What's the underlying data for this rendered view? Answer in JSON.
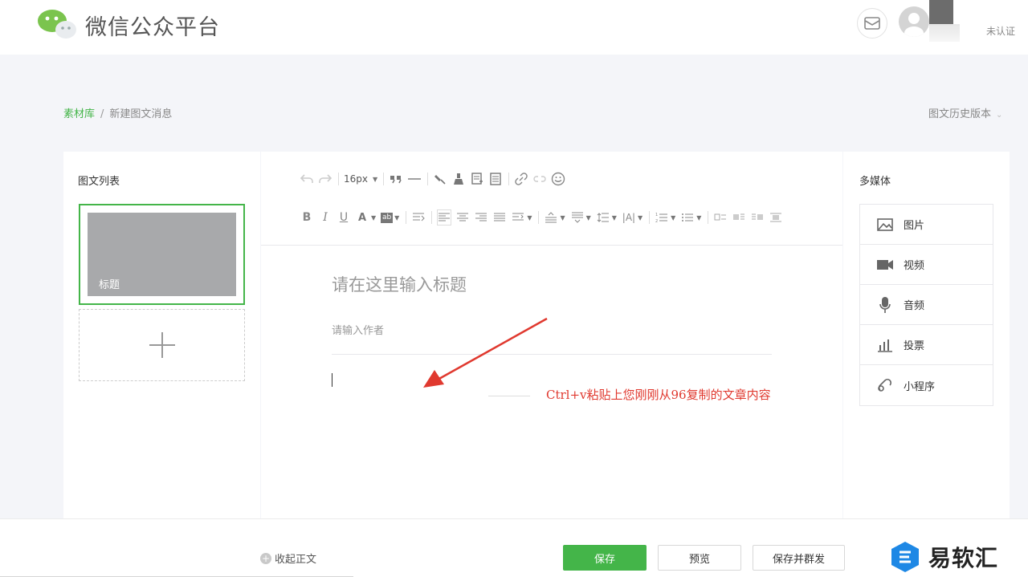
{
  "header": {
    "brand": "微信公众平台",
    "verify_status": "未认证"
  },
  "breadcrumb": {
    "home": "素材库",
    "separator": "/",
    "current": "新建图文消息",
    "history": "图文历史版本"
  },
  "left_panel": {
    "title": "图文列表",
    "card_title": "标题",
    "add_icon": "plus-icon"
  },
  "toolbar": {
    "font_size": "16px",
    "row1_icons": [
      "undo-icon",
      "redo-icon",
      "font-size-select",
      "blockquote-icon",
      "horizontal-rule-icon",
      "format-painter-icon",
      "clear-format-icon",
      "insert-template-icon",
      "insert-doc-icon",
      "link-icon",
      "unlink-icon",
      "emoji-icon"
    ],
    "row2_icons": [
      "bold-icon",
      "italic-icon",
      "underline-icon",
      "font-color-icon",
      "highlight-icon",
      "indent-icon",
      "align-left-icon",
      "align-center-icon",
      "align-right-icon",
      "align-justify-icon",
      "spacing-icon",
      "paragraph-before-icon",
      "paragraph-after-icon",
      "line-height-icon",
      "letter-spacing-icon",
      "ordered-list-icon",
      "unordered-list-icon",
      "float-none-icon",
      "float-left-icon",
      "float-right-icon",
      "float-center-icon"
    ],
    "row2_labels": {
      "bold": "B",
      "italic": "I",
      "underline": "U",
      "font_color": "A",
      "highlight": "ab",
      "letter_spacing": "|A|"
    }
  },
  "editor": {
    "title_placeholder": "请在这里输入标题",
    "author_placeholder": "请输入作者",
    "annotation": "Ctrl+v粘贴上您刚刚从96复制的文章内容"
  },
  "media": {
    "title": "多媒体",
    "items": [
      {
        "label": "图片",
        "icon": "image-icon"
      },
      {
        "label": "视频",
        "icon": "video-icon"
      },
      {
        "label": "音频",
        "icon": "microphone-icon"
      },
      {
        "label": "投票",
        "icon": "bar-chart-icon"
      },
      {
        "label": "小程序",
        "icon": "mini-program-icon"
      }
    ]
  },
  "footer": {
    "collapse": "收起正文",
    "save": "保存",
    "preview": "预览",
    "save_send": "保存并群发"
  },
  "watermark": {
    "text": "易软汇"
  },
  "colors": {
    "accent": "#44b549",
    "annotation": "#e0392f",
    "cover": "#a8a9ab"
  }
}
